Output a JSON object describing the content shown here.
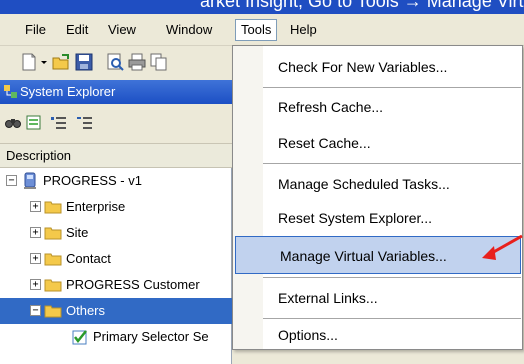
{
  "banner": {
    "text": "arket Insight, Go to Tools → Manage Virtual"
  },
  "menubar": {
    "items": [
      {
        "label": "File"
      },
      {
        "label": "Edit"
      },
      {
        "label": "View"
      },
      {
        "label": "Window"
      },
      {
        "label": "Tools"
      },
      {
        "label": "Help"
      }
    ]
  },
  "toolbar": {
    "icons": [
      "new-document-icon",
      "dropdown-arrow-icon",
      "open-folder-icon",
      "save-icon",
      "print-preview-icon",
      "print-icon",
      "copy-icon"
    ]
  },
  "explorer": {
    "title": "System Explorer",
    "tool_icons": [
      "find-icon",
      "properties-icon",
      "sort-icon",
      "list-icon"
    ],
    "column_header": "Description",
    "tree": [
      {
        "label": "PROGRESS - v1",
        "expander": "−",
        "icon": "computer-icon"
      },
      {
        "label": "Enterprise",
        "expander": "+",
        "icon": "folder-icon"
      },
      {
        "label": "Site",
        "expander": "+",
        "icon": "folder-icon"
      },
      {
        "label": "Contact",
        "expander": "+",
        "icon": "folder-icon"
      },
      {
        "label": "PROGRESS Customer",
        "expander": "+",
        "icon": "folder-icon"
      },
      {
        "label": "Others",
        "expander": "−",
        "icon": "folder-icon",
        "selected": true
      },
      {
        "label": "Primary Selector Se",
        "icon": "checkbox-icon"
      }
    ]
  },
  "tools_menu": {
    "items": [
      {
        "label": "Check For New Variables..."
      },
      {
        "label": "Refresh Cache..."
      },
      {
        "label": "Reset Cache..."
      },
      {
        "label": "Manage Scheduled Tasks..."
      },
      {
        "label": "Reset System Explorer..."
      },
      {
        "label": "Manage Virtual Variables...",
        "highlighted": true
      },
      {
        "label": "External Links..."
      },
      {
        "label": "Options..."
      }
    ]
  },
  "colors": {
    "banner": "#1f4ec2",
    "chrome": "#ece9d8",
    "selection": "#316ac5",
    "menu_highlight": "#c1d2ee",
    "arrow": "#e8201c",
    "folder": "#f4c94a"
  }
}
